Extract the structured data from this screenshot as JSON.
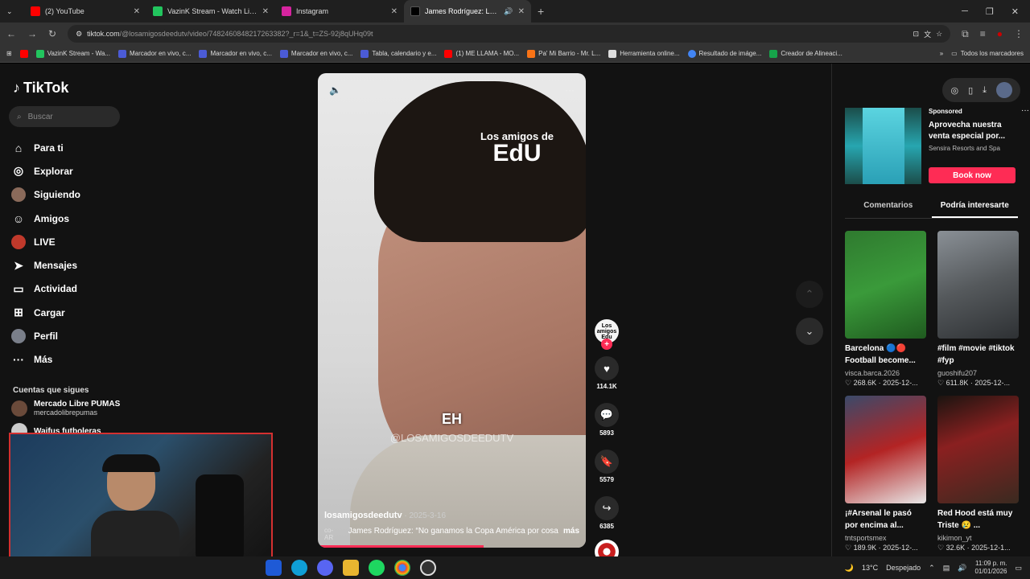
{
  "browser": {
    "tabs": [
      {
        "title": "(2) YouTube",
        "color": "#ff0000"
      },
      {
        "title": "VazinK Stream - Watch Live on",
        "color": "#22c55e"
      },
      {
        "title": "Instagram",
        "color": "#d6249f"
      },
      {
        "title": "James Rodríguez: La verdad",
        "color": "#000000"
      }
    ],
    "url_domain": "tiktok.com",
    "url_path": "/@losamigosdeedutv/video/7482460848217263382?_r=1&_t=ZS-92j8qUHq09t",
    "bookmarks": [
      "VazinK Stream - Wa...",
      "Marcador en vivo, c...",
      "Marcador en vivo, c...",
      "Marcador en vivo, c...",
      "Tabla, calendario y e...",
      "(1) ME LLAMA - MO...",
      "Pa' Mi Barrio - Mr. L...",
      "Herramienta online...",
      "Resultado de imáge...",
      "Creador de Alineaci..."
    ],
    "all_bookmarks": "Todos los marcadores"
  },
  "sidebar": {
    "logo": "TikTok",
    "search_placeholder": "Buscar",
    "nav": [
      {
        "label": "Para ti",
        "icon": "home-icon",
        "glyph": "⌂"
      },
      {
        "label": "Explorar",
        "icon": "compass-icon",
        "glyph": "◎"
      },
      {
        "label": "Siguiendo",
        "icon": "avatar-icon",
        "glyph": ""
      },
      {
        "label": "Amigos",
        "icon": "friends-icon",
        "glyph": "☺"
      },
      {
        "label": "LIVE",
        "icon": "avatar-icon",
        "glyph": ""
      },
      {
        "label": "Mensajes",
        "icon": "send-icon",
        "glyph": "➤"
      },
      {
        "label": "Actividad",
        "icon": "activity-icon",
        "glyph": "▭"
      },
      {
        "label": "Cargar",
        "icon": "upload-icon",
        "glyph": "⊞"
      },
      {
        "label": "Perfil",
        "icon": "avatar-icon",
        "glyph": ""
      },
      {
        "label": "Más",
        "icon": "more-icon",
        "glyph": "···"
      }
    ],
    "following_title": "Cuentas que sigues",
    "following": [
      {
        "name": "Mercado Libre PUMAS",
        "handle": "mercadolibrepumas"
      },
      {
        "name": "Waifus futboleras",
        "handle": ""
      }
    ]
  },
  "video": {
    "logo_top": "Los amigos de",
    "logo_bottom": "EdU",
    "caption": "EH",
    "watermark": "@LOSAMIGOSDEEDUTV",
    "author": "losamigosdeedutv",
    "date": "· 2025-3-16",
    "desc_prefix": "co- AR",
    "desc": "James Rodríguez: “No ganamos la Copa América por cosas",
    "more": "más",
    "progress": 0.62
  },
  "actions": {
    "avatar_text": "Los amigos Edu",
    "likes": "114.1K",
    "comments": "5893",
    "saves": "5579",
    "shares": "6385"
  },
  "right": {
    "ad": {
      "sponsored": "Sponsored",
      "headline": "Aprovecha nuestra venta especial por...",
      "brand": "Sensira Resorts and Spa",
      "cta": "Book now"
    },
    "tabs": [
      "Comentarios",
      "Podría interesarte"
    ],
    "cards": [
      {
        "title": "Barcelona 🔵🔴 Football become...",
        "user": "visca.barca.2026",
        "meta": "♡ 268.6K · 2025-12-...",
        "color": "#2f6a2f"
      },
      {
        "title": "#film #movie #tiktok #fyp",
        "user": "guoshifu207",
        "meta": "♡ 611.8K · 2025-12-...",
        "color": "#55595c"
      },
      {
        "title": "¡#Arsenal le pasó por encima al...",
        "user": "tntsportsmex",
        "meta": "♡ 189.9K · 2025-12-...",
        "color": "#b32424"
      },
      {
        "title": "Red Hood está muy Triste 😢 ...",
        "user": "kikimon_yt",
        "meta": "♡ 32.6K · 2025-12-1...",
        "color": "#3a2a20"
      }
    ]
  },
  "taskbar": {
    "weather": "13°C",
    "weather_text": "Despejado",
    "time": "11:09 p. m.",
    "date": "01/01/2026"
  }
}
